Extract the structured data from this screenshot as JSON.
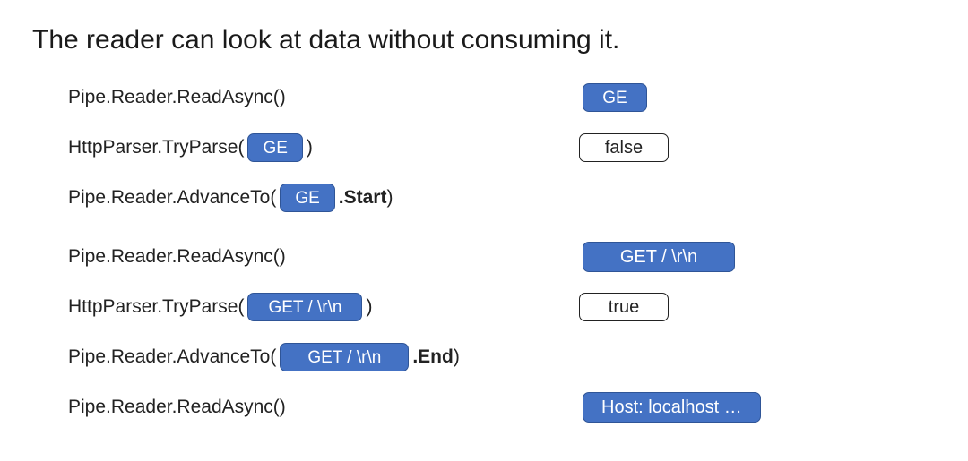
{
  "title": "The reader can look at data without consuming it.",
  "rows": [
    {
      "prefix": "Pipe.Reader.ReadAsync()",
      "chip": "",
      "suffix": "",
      "suffix_bold": "",
      "result_chip": "GE",
      "result_plain": ""
    },
    {
      "prefix": "HttpParser.TryParse(",
      "chip": "GE",
      "suffix": ")",
      "suffix_bold": "",
      "result_chip": "",
      "result_plain": "false"
    },
    {
      "prefix": "Pipe.Reader.AdvanceTo(",
      "chip": "GE",
      "suffix": ")",
      "suffix_bold": ".Start",
      "result_chip": "",
      "result_plain": ""
    },
    {
      "prefix": "Pipe.Reader.ReadAsync()",
      "chip": "",
      "suffix": "",
      "suffix_bold": "",
      "result_chip": "GET / \\r\\n",
      "result_plain": ""
    },
    {
      "prefix": "HttpParser.TryParse(",
      "chip": "GET / \\r\\n",
      "suffix": ")",
      "suffix_bold": "",
      "result_chip": "",
      "result_plain": "true"
    },
    {
      "prefix": "Pipe.Reader.AdvanceTo(",
      "chip": "GET / \\r\\n",
      "suffix": ")",
      "suffix_bold": ".End",
      "result_chip": "",
      "result_plain": ""
    },
    {
      "prefix": "Pipe.Reader.ReadAsync()",
      "chip": "",
      "suffix": "",
      "suffix_bold": "",
      "result_chip": "Host: localhost …",
      "result_plain": ""
    }
  ]
}
